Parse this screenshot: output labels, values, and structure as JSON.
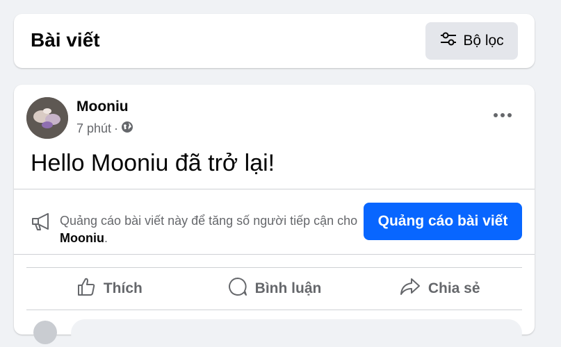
{
  "header": {
    "title": "Bài viết",
    "filter_label": "Bộ lọc",
    "filter_icon": "sliders-icon"
  },
  "post": {
    "author": "Mooniu",
    "time": "7 phút",
    "separator": "·",
    "privacy_icon": "globe-icon",
    "text": "Hello Mooniu đã trở lại!",
    "more_icon": "more-horizontal-icon"
  },
  "promo": {
    "icon": "megaphone-icon",
    "text_before": "Quảng cáo bài viết này để tăng số người tiếp cận cho ",
    "text_name": "Mooniu",
    "text_after": ".",
    "button_label": "Quảng cáo bài viết",
    "button_color": "#0866ff"
  },
  "actions": [
    {
      "label": "Thích",
      "icon": "thumbs-up-icon"
    },
    {
      "label": "Bình luận",
      "icon": "comment-icon"
    },
    {
      "label": "Chia sẻ",
      "icon": "share-icon"
    }
  ]
}
